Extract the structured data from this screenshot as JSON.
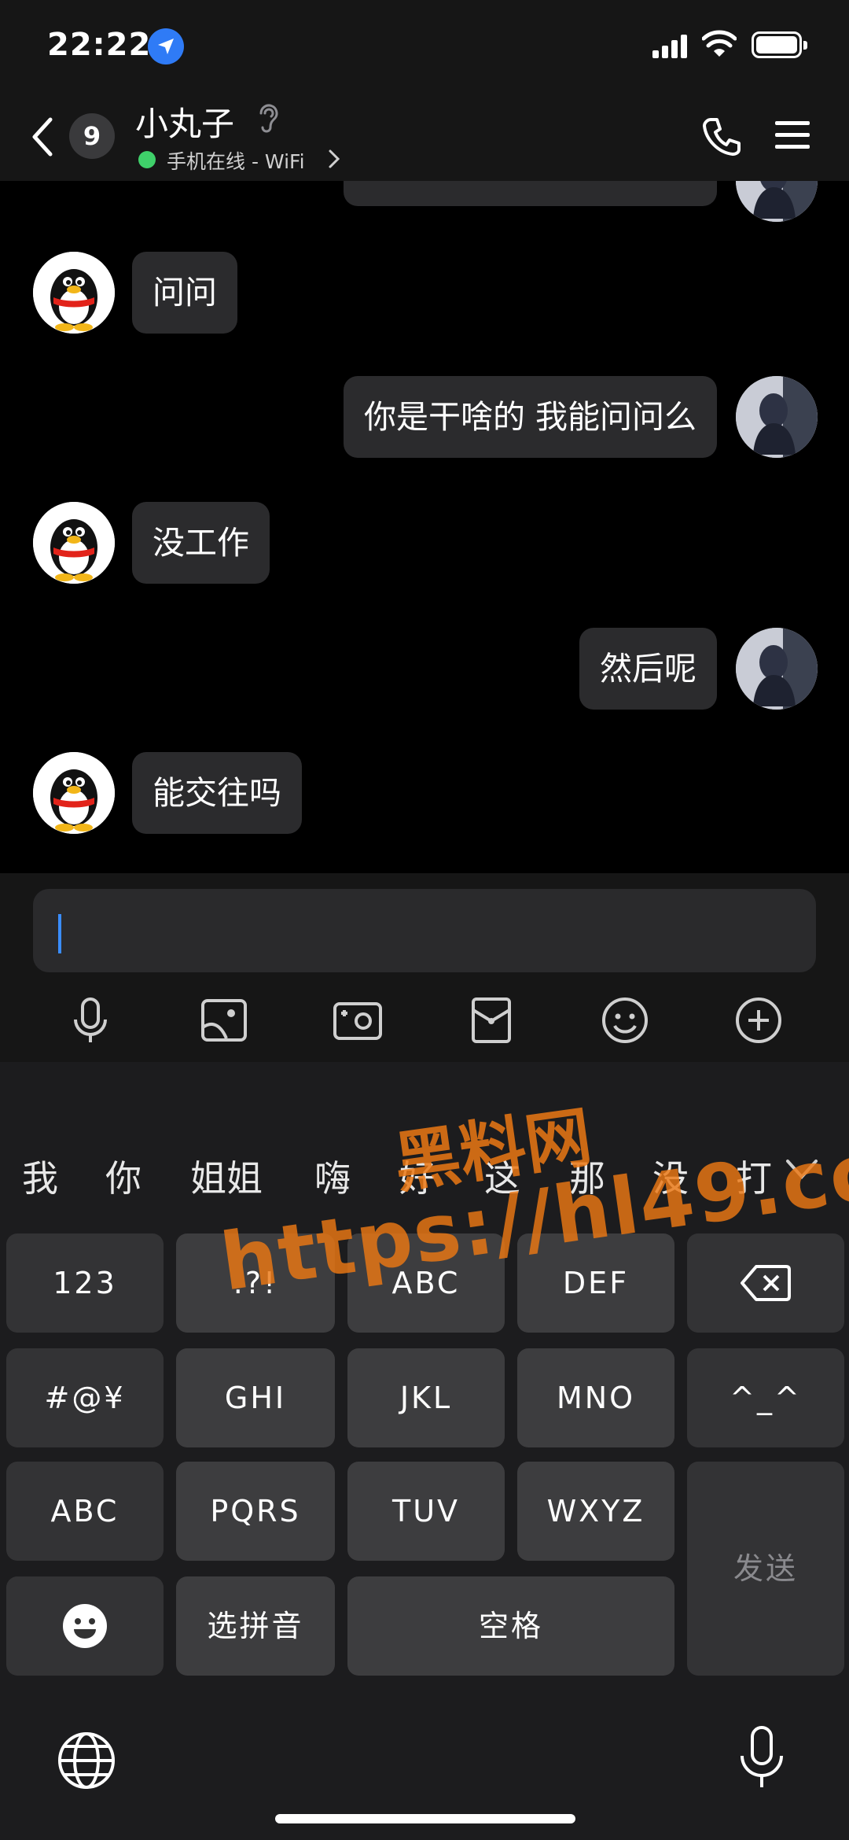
{
  "status_bar": {
    "time": "22:22"
  },
  "header": {
    "unread_count": "9",
    "contact_name": "小丸子",
    "status_text": "手机在线 - WiFi"
  },
  "messages": [
    {
      "side": "right",
      "text": "你是干啥的 我能问问么"
    },
    {
      "side": "left",
      "text": "问问"
    },
    {
      "side": "right",
      "text": "你是干啥的 我能问问么"
    },
    {
      "side": "left",
      "text": "没工作"
    },
    {
      "side": "right",
      "text": "然后呢"
    },
    {
      "side": "left",
      "text": "能交往吗"
    }
  ],
  "toolbar": {
    "icons": [
      "microphone-icon",
      "image-icon",
      "camera-icon",
      "red-envelope-icon",
      "emoji-icon",
      "plus-icon"
    ]
  },
  "keyboard": {
    "candidates": [
      "我",
      "你",
      "姐姐",
      "嗨",
      "好",
      "这",
      "那",
      "没",
      "打"
    ],
    "keys": {
      "num": "123",
      "punct": ".?!",
      "abc": "ABC",
      "def": "DEF",
      "symbols": "#@¥",
      "ghi": "GHI",
      "jkl": "JKL",
      "mno": "MNO",
      "face": "^_^",
      "abc_switch": "ABC",
      "pqrs": "PQRS",
      "tuv": "TUV",
      "wxyz": "WXYZ",
      "send": "发送",
      "pinyin": "选拼音",
      "space": "空格"
    }
  },
  "watermark": {
    "line1": "黑料网",
    "line2": "https://hl49.co"
  }
}
